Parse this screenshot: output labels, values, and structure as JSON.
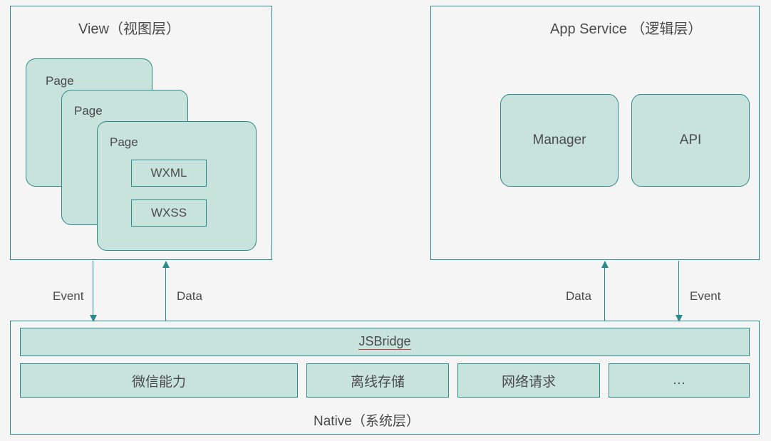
{
  "view": {
    "title": "View（视图层）",
    "pages": [
      "Page",
      "Page",
      "Page"
    ],
    "inner": [
      "WXML",
      "WXSS"
    ]
  },
  "appservice": {
    "title": "App Service （逻辑层）",
    "boxes": [
      "Manager",
      "API"
    ]
  },
  "arrows": {
    "left_down": "Event",
    "left_up": "Data",
    "right_up": "Data",
    "right_down": "Event"
  },
  "native": {
    "bridge": "JSBridge",
    "items": [
      "微信能力",
      "离线存储",
      "网络请求",
      "…"
    ],
    "title": "Native（系统层）"
  }
}
